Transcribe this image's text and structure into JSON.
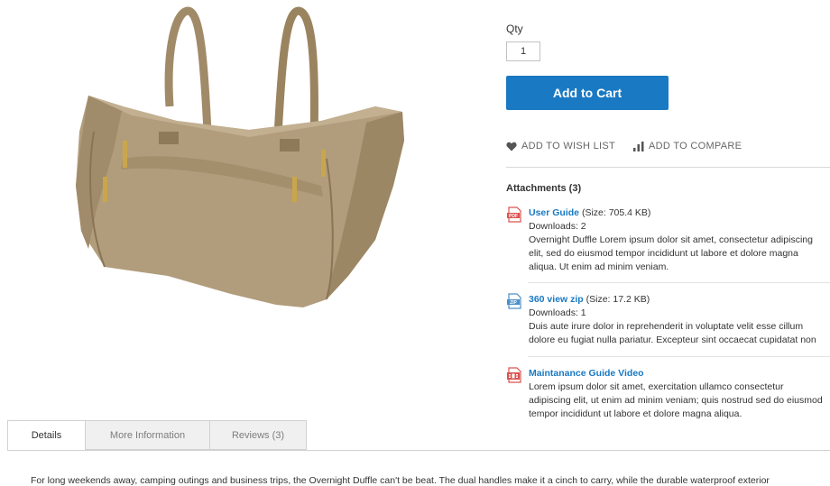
{
  "product": {
    "image_icon": "duffle-bag-image"
  },
  "purchase": {
    "qty_label": "Qty",
    "qty_value": "1",
    "add_to_cart_label": "Add to Cart",
    "button_color": "#1979c3"
  },
  "actions": {
    "wishlist_label": "ADD TO WISH LIST",
    "wishlist_icon": "heart-icon",
    "compare_label": "ADD TO COMPARE",
    "compare_icon": "bar-chart-icon"
  },
  "attachments": {
    "title": "Attachments (3)",
    "items": [
      {
        "icon": "pdf-file-icon",
        "name": "User Guide",
        "size": "(Size: 705.4 KB)",
        "downloads": "Downloads: 2",
        "desc_lines": [
          "Overnight Duffle Lorem ipsum dolor sit amet, consectetur adipiscing",
          "elit, sed do eiusmod tempor incididunt ut labore et dolore magna",
          "aliqua. Ut enim ad minim veniam."
        ]
      },
      {
        "icon": "zip-file-icon",
        "name": "360 view zip",
        "size": "(Size: 17.2 KB)",
        "downloads": "Downloads: 1",
        "desc_lines": [
          "Duis aute irure dolor in reprehenderit in voluptate velit esse cillum",
          "dolore eu fugiat nulla pariatur. Excepteur sint occaecat cupidatat non"
        ]
      },
      {
        "icon": "video-file-icon",
        "name": "Maintanance Guide Video",
        "desc_lines": [
          "Lorem ipsum dolor sit amet, exercitation ullamco consectetur",
          "adipiscing elit, ut enim ad minim veniam; quis nostrud sed do eiusmod",
          "tempor incididunt ut labore et dolore magna aliqua."
        ]
      }
    ]
  },
  "tabs": [
    {
      "label": "Details",
      "active": true
    },
    {
      "label": "More Information",
      "active": false
    },
    {
      "label": "Reviews (3)",
      "active": false
    }
  ],
  "description": "For long weekends away, camping outings and business trips, the Overnight Duffle can't be beat. The dual handles make it a cinch to carry, while the durable waterproof exterior"
}
